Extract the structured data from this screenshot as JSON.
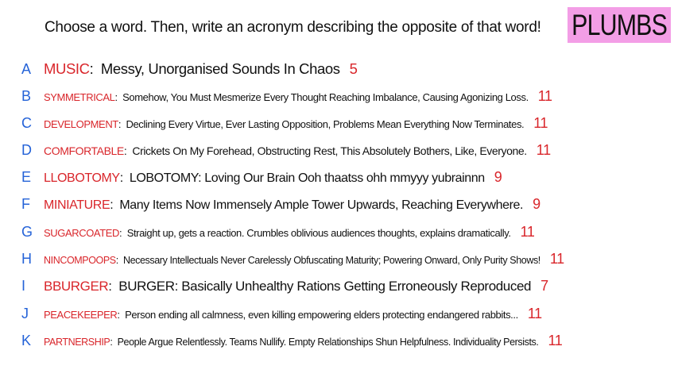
{
  "header": {
    "prompt": "Choose a word. Then, write an acronym describing the opposite of that word!",
    "team_name": "PLUMBS"
  },
  "colors": {
    "letter": "#2563d8",
    "word": "#d9262b",
    "score": "#d9262b",
    "badge_background": "#f39ee6",
    "text": "#111111"
  },
  "answers": [
    {
      "letter": "A",
      "word": "MUSIC",
      "acronym": "Messy, Unorganised Sounds In Chaos",
      "score": "5"
    },
    {
      "letter": "B",
      "word": "SYMMETRICAL",
      "acronym": "Somehow, You Must Mesmerize Every Thought Reaching Imbalance, Causing Agonizing Loss.",
      "score": "11"
    },
    {
      "letter": "C",
      "word": "DEVELOPMENT",
      "acronym": "Declining Every Virtue, Ever Lasting Opposition, Problems Mean Everything Now Terminates.",
      "score": "11"
    },
    {
      "letter": "D",
      "word": "COMFORTABLE",
      "acronym": "Crickets On My Forehead, Obstructing Rest, This Absolutely Bothers, Like, Everyone.",
      "score": "11"
    },
    {
      "letter": "E",
      "word": "LLOBOTOMY",
      "acronym": "LOBOTOMY: Loving Our Brain Ooh thaatss ohh mmyyy yubrainnn",
      "score": "9"
    },
    {
      "letter": "F",
      "word": "MINIATURE",
      "acronym": "Many Items Now Immensely Ample Tower Upwards, Reaching Everywhere.",
      "score": "9"
    },
    {
      "letter": "G",
      "word": "SUGARCOATED",
      "acronym": "Straight up, gets a reaction. Crumbles oblivious audiences thoughts, explains dramatically.",
      "score": "11"
    },
    {
      "letter": "H",
      "word": "NINCOMPOOPS",
      "acronym": "Necessary Intellectuals Never Carelessly Obfuscating Maturity; Powering Onward, Only Purity Shows!",
      "score": "11"
    },
    {
      "letter": "I",
      "word": "BBURGER",
      "acronym": "BURGER: Basically Unhealthy Rations Getting Erroneously Reproduced",
      "score": "7"
    },
    {
      "letter": "J",
      "word": "PEACEKEEPER",
      "acronym": "Person ending all calmness, even killing empowering elders protecting endangered rabbits...",
      "score": "11"
    },
    {
      "letter": "K",
      "word": "PARTNERSHIP",
      "acronym": "People Argue Relentlessly. Teams Nullify. Empty Relationships Shun Helpfulness. Individuality Persists.",
      "score": "11"
    }
  ]
}
